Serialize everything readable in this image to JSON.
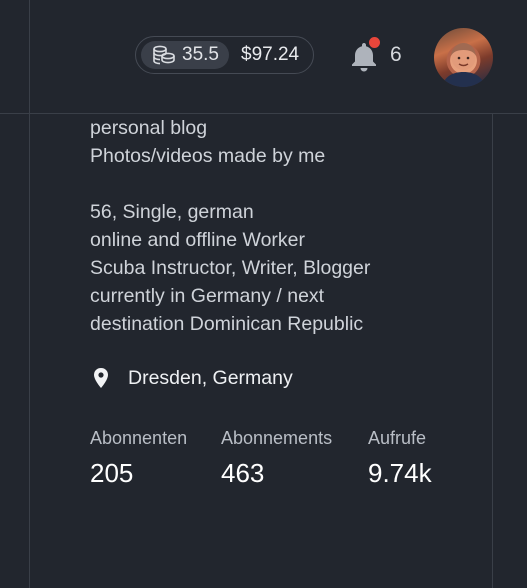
{
  "header": {
    "wallet": {
      "coins": "35.5",
      "cash": "$97.24",
      "coin_icon": "coins-stack-icon"
    },
    "notifications": {
      "icon": "bell-icon",
      "count": "6",
      "has_unread": true,
      "dot_color": "#e8463b"
    },
    "avatar": {
      "icon": "user-avatar"
    }
  },
  "profile": {
    "bio_lines": [
      "personal blog",
      "Photos/videos made by me",
      "",
      "56, Single, german",
      "online and offline Worker",
      "Scuba Instructor, Writer, Blogger",
      "currently in Germany / next",
      "destination Dominican Republic"
    ],
    "location": {
      "icon": "location-pin-icon",
      "text": "Dresden, Germany"
    },
    "stats": [
      {
        "label": "Abonnenten",
        "value": "205"
      },
      {
        "label": "Abonnements",
        "value": "463"
      },
      {
        "label": "Aufrufe",
        "value": "9.74k"
      }
    ]
  },
  "colors": {
    "background": "#22262e",
    "divider": "#3a3f48",
    "text": "#cfd3d9",
    "value_text": "#ffffff"
  }
}
